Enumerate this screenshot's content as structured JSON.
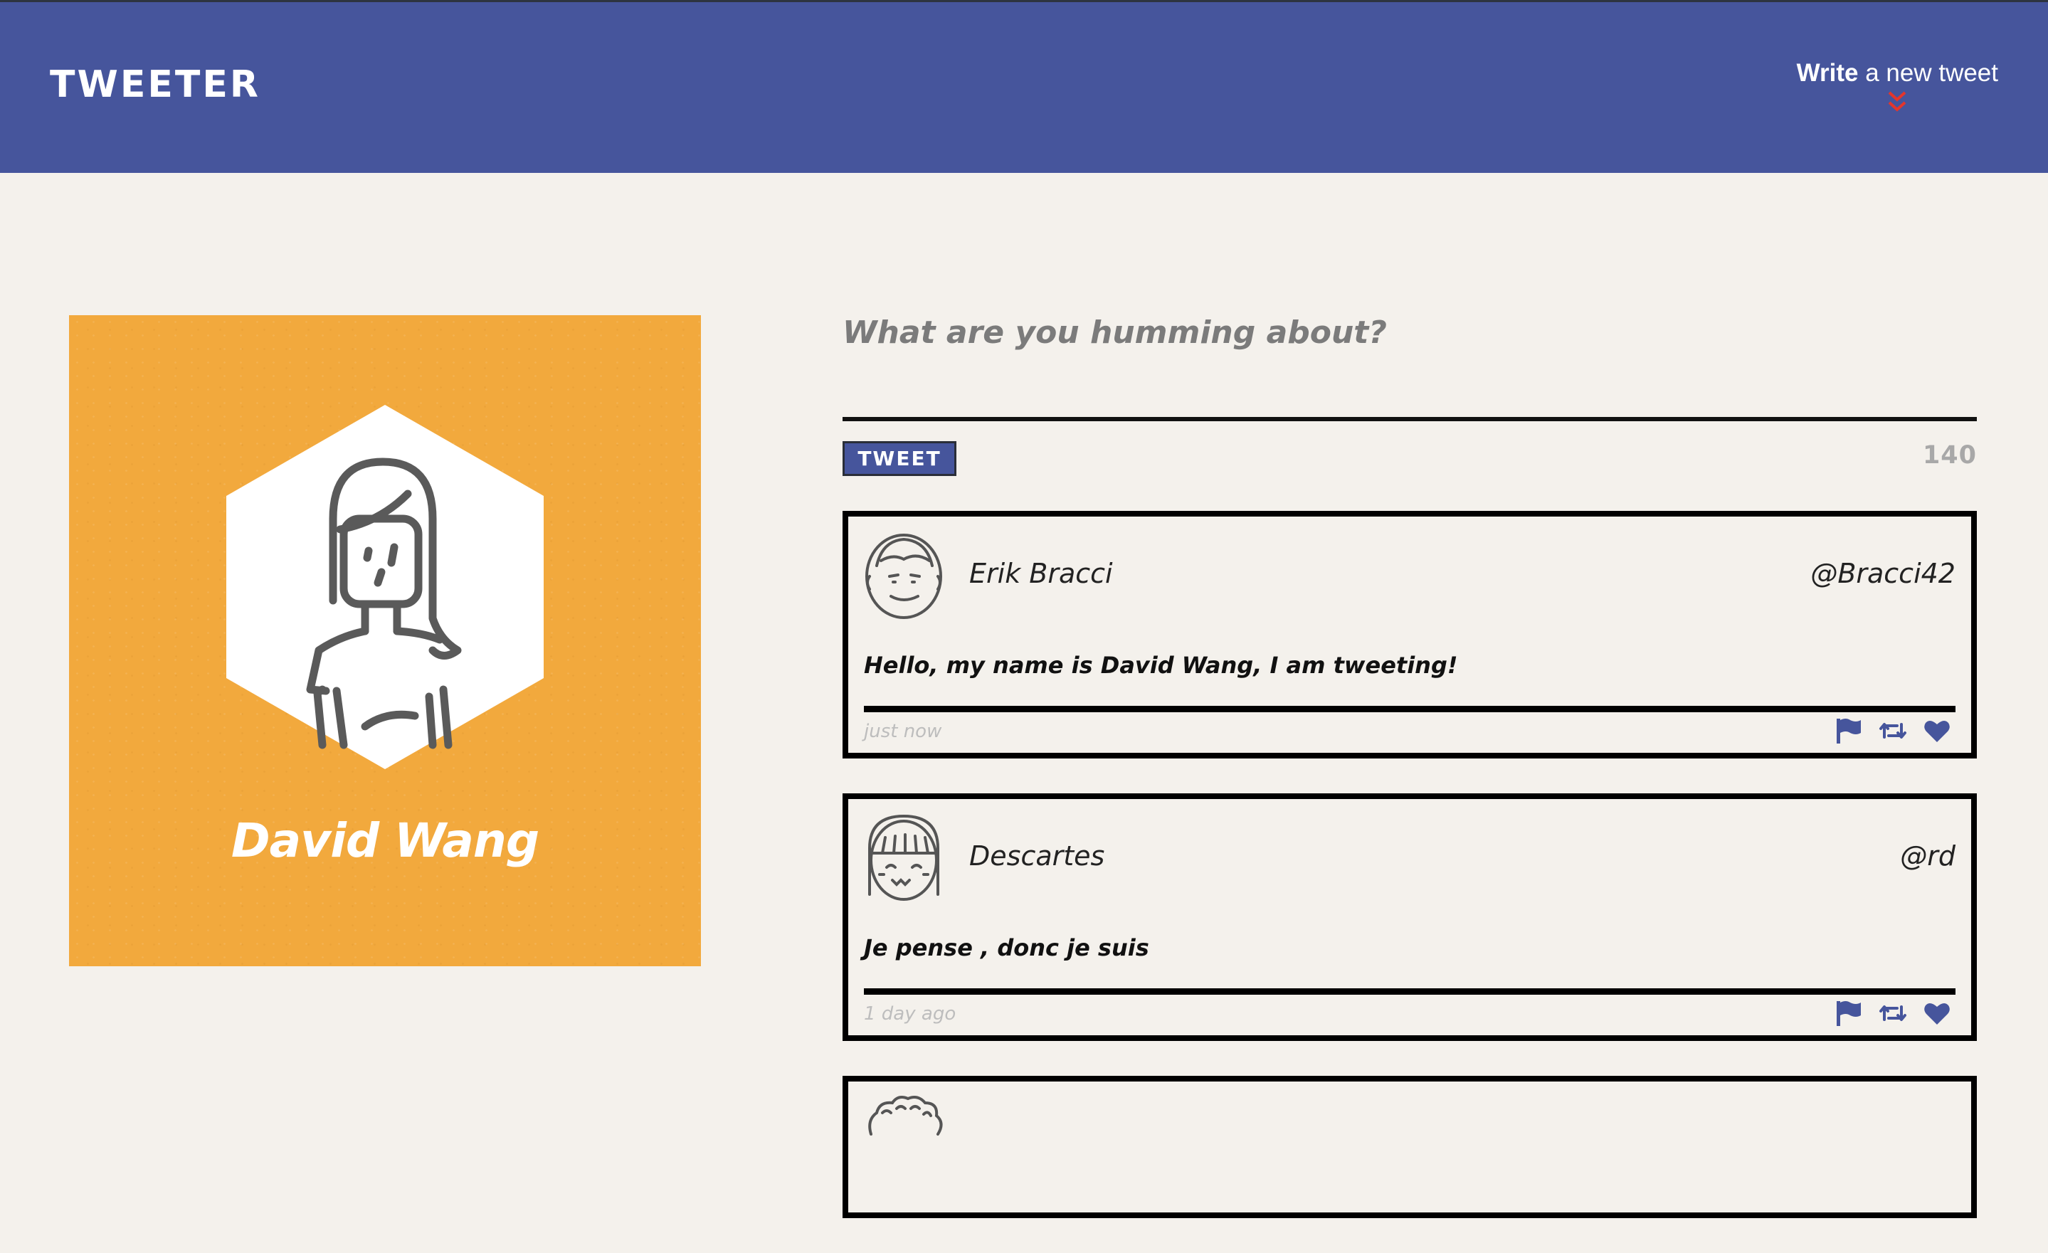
{
  "header": {
    "brand": "TWEETER",
    "compose_toggle_strong": "Write",
    "compose_toggle_rest": "a new tweet",
    "brand_color": "#46559c",
    "chevron_color": "#e5352b"
  },
  "profile": {
    "name": "David Wang",
    "background_color": "#f2a93d",
    "avatar_icon": "girl-avatar-icon"
  },
  "composer": {
    "placeholder": "What are you humming about?",
    "value": "",
    "submit_label": "TWEET",
    "char_counter": "140"
  },
  "tweets": [
    {
      "user_name": "Erik Bracci",
      "handle": "@Bracci42",
      "content": "Hello, my name is David Wang, I am tweeting!",
      "timestamp": "just now",
      "avatar_icon": "man-avatar-icon",
      "actions": [
        "flag-icon",
        "retweet-icon",
        "heart-icon"
      ]
    },
    {
      "user_name": "Descartes",
      "handle": "@rd",
      "content": "Je pense , donc je suis",
      "timestamp": "1 day ago",
      "avatar_icon": "girl-bangs-avatar-icon",
      "actions": [
        "flag-icon",
        "retweet-icon",
        "heart-icon"
      ]
    }
  ],
  "partial_tweet": {
    "avatar_icon": "curly-hair-avatar-icon"
  }
}
